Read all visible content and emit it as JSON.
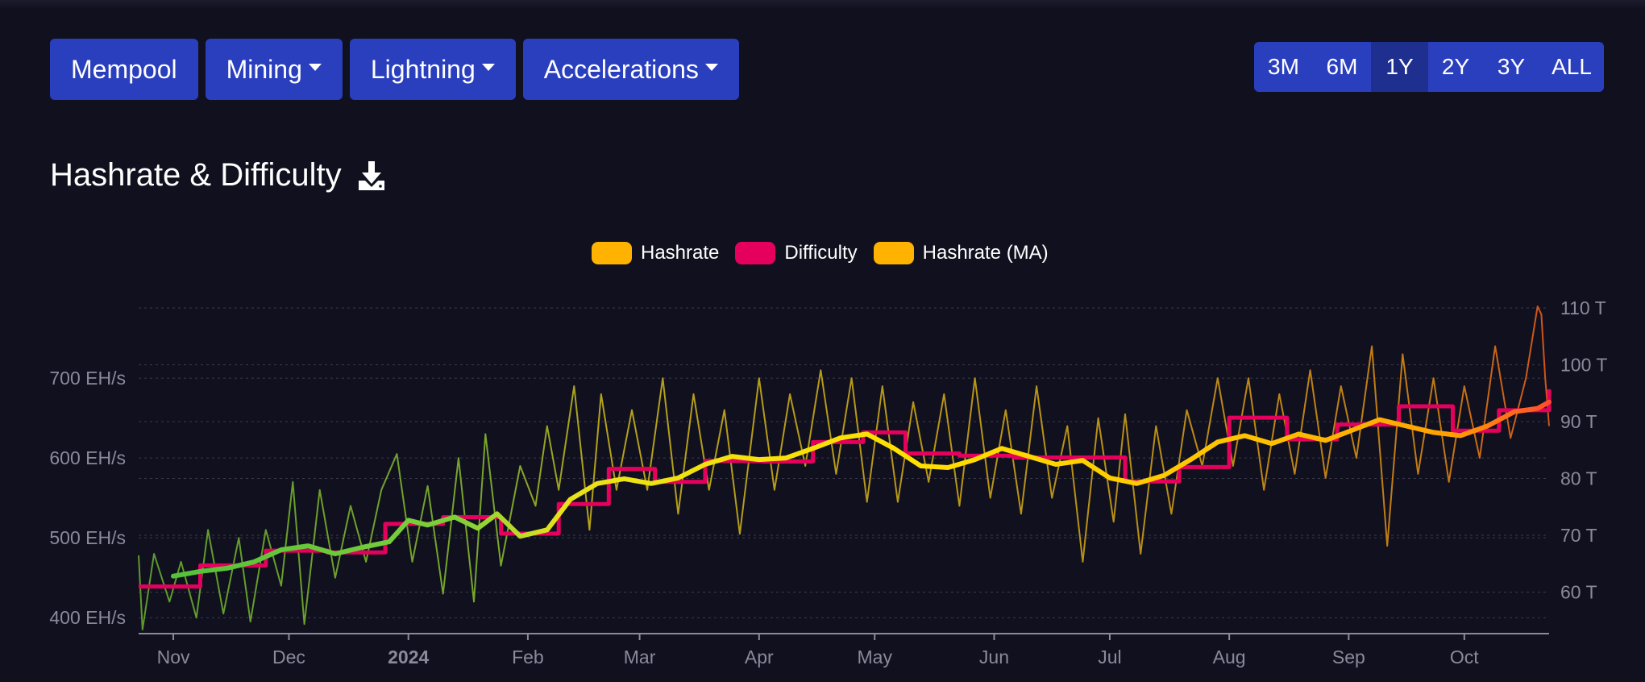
{
  "nav": {
    "items": [
      {
        "label": "Mempool",
        "dropdown": false
      },
      {
        "label": "Mining",
        "dropdown": true
      },
      {
        "label": "Lightning",
        "dropdown": true
      },
      {
        "label": "Accelerations",
        "dropdown": true
      }
    ]
  },
  "ranges": {
    "items": [
      "3M",
      "6M",
      "1Y",
      "2Y",
      "3Y",
      "ALL"
    ],
    "active": "1Y"
  },
  "page": {
    "title": "Hashrate & Difficulty",
    "download_icon": "download-icon"
  },
  "colors": {
    "background": "#11101f",
    "button": "#2a3fbe",
    "button_active": "#1e2f8f",
    "hashrate": "#ffb300",
    "difficulty": "#e5005e",
    "hashrate_ma": "#ffb300",
    "grid": "#3a3a4a",
    "axis_text": "#8a8a9a"
  },
  "chart_data": {
    "type": "line",
    "legend": {
      "position": "top-center",
      "entries": [
        {
          "name": "Hashrate",
          "color": "#ffb300"
        },
        {
          "name": "Difficulty",
          "color": "#e5005e"
        },
        {
          "name": "Hashrate (MA)",
          "color": "#ffb300"
        }
      ]
    },
    "x_ticks": [
      "Nov",
      "Dec",
      "2024",
      "Feb",
      "Mar",
      "Apr",
      "May",
      "Jun",
      "Jul",
      "Aug",
      "Sep",
      "Oct"
    ],
    "x_bold_tick": "2024",
    "x_range": [
      "2023-10-23",
      "2024-10-23"
    ],
    "y_left": {
      "ticks": [
        "400 EH/s",
        "500 EH/s",
        "600 EH/s",
        "700 EH/s"
      ],
      "tick_values": [
        400,
        500,
        600,
        700
      ],
      "range": [
        380,
        795
      ],
      "unit": "EH/s"
    },
    "y_right": {
      "ticks": [
        "60 T",
        "70 T",
        "80 T",
        "90 T",
        "100 T",
        "110 T"
      ],
      "tick_values": [
        60,
        70,
        80,
        90,
        100,
        110
      ],
      "range": [
        52.7,
        111
      ],
      "unit": "T"
    },
    "grid": true,
    "series": [
      {
        "name": "Difficulty",
        "axis": "right",
        "unit": "T",
        "color": "#e5005e",
        "steps": [
          [
            "2023-10-23",
            61.0
          ],
          [
            "2023-11-08",
            64.7
          ],
          [
            "2023-11-25",
            67.3
          ],
          [
            "2023-12-11",
            67.0
          ],
          [
            "2023-12-26",
            72.0
          ],
          [
            "2024-01-10",
            73.2
          ],
          [
            "2024-01-25",
            70.3
          ],
          [
            "2024-02-09",
            75.5
          ],
          [
            "2024-02-22",
            81.7
          ],
          [
            "2024-03-05",
            79.4
          ],
          [
            "2024-03-18",
            83.1
          ],
          [
            "2024-04-02",
            83.0
          ],
          [
            "2024-04-15",
            86.4
          ],
          [
            "2024-04-28",
            88.1
          ],
          [
            "2024-05-09",
            84.4
          ],
          [
            "2024-05-23",
            84.0
          ],
          [
            "2024-06-06",
            83.7
          ],
          [
            "2024-06-21",
            83.7
          ],
          [
            "2024-07-05",
            79.5
          ],
          [
            "2024-07-19",
            82.0
          ],
          [
            "2024-08-01",
            90.7
          ],
          [
            "2024-08-16",
            86.9
          ],
          [
            "2024-08-29",
            89.5
          ],
          [
            "2024-09-14",
            92.7
          ],
          [
            "2024-09-28",
            88.4
          ],
          [
            "2024-10-10",
            92.0
          ],
          [
            "2024-10-23",
            95.7
          ]
        ]
      },
      {
        "name": "Hashrate (MA)",
        "axis": "left",
        "unit": "EH/s",
        "color_gradient": [
          "#4fbf3a",
          "#ffe600",
          "#ffb300",
          "#ff4d2d"
        ],
        "points": [
          [
            "2023-11-01",
            452
          ],
          [
            "2023-11-08",
            458
          ],
          [
            "2023-11-15",
            462
          ],
          [
            "2023-11-22",
            470
          ],
          [
            "2023-11-29",
            485
          ],
          [
            "2023-12-06",
            490
          ],
          [
            "2023-12-13",
            480
          ],
          [
            "2023-12-20",
            488
          ],
          [
            "2023-12-27",
            495
          ],
          [
            "2024-01-01",
            522
          ],
          [
            "2024-01-06",
            516
          ],
          [
            "2024-01-13",
            526
          ],
          [
            "2024-01-19",
            512
          ],
          [
            "2024-01-24",
            530
          ],
          [
            "2024-01-30",
            502
          ],
          [
            "2024-02-06",
            510
          ],
          [
            "2024-02-12",
            548
          ],
          [
            "2024-02-19",
            568
          ],
          [
            "2024-02-26",
            574
          ],
          [
            "2024-03-04",
            568
          ],
          [
            "2024-03-11",
            575
          ],
          [
            "2024-03-18",
            592
          ],
          [
            "2024-03-25",
            602
          ],
          [
            "2024-04-01",
            598
          ],
          [
            "2024-04-08",
            600
          ],
          [
            "2024-04-15",
            612
          ],
          [
            "2024-04-22",
            625
          ],
          [
            "2024-04-29",
            630
          ],
          [
            "2024-05-06",
            612
          ],
          [
            "2024-05-13",
            590
          ],
          [
            "2024-05-20",
            588
          ],
          [
            "2024-05-27",
            598
          ],
          [
            "2024-06-03",
            612
          ],
          [
            "2024-06-10",
            602
          ],
          [
            "2024-06-17",
            592
          ],
          [
            "2024-06-24",
            597
          ],
          [
            "2024-07-01",
            575
          ],
          [
            "2024-07-08",
            568
          ],
          [
            "2024-07-15",
            578
          ],
          [
            "2024-07-22",
            598
          ],
          [
            "2024-07-29",
            620
          ],
          [
            "2024-08-05",
            628
          ],
          [
            "2024-08-12",
            618
          ],
          [
            "2024-08-19",
            630
          ],
          [
            "2024-08-26",
            622
          ],
          [
            "2024-09-02",
            635
          ],
          [
            "2024-09-09",
            648
          ],
          [
            "2024-09-16",
            640
          ],
          [
            "2024-09-23",
            632
          ],
          [
            "2024-09-30",
            628
          ],
          [
            "2024-10-07",
            640
          ],
          [
            "2024-10-14",
            658
          ],
          [
            "2024-10-20",
            662
          ],
          [
            "2024-10-23",
            670
          ]
        ]
      },
      {
        "name": "Hashrate",
        "axis": "left",
        "unit": "EH/s",
        "note_on_values": "daily estimates read approximately; daily noise around MA with range ~385 to ~790",
        "points": [
          [
            "2023-10-23",
            478
          ],
          [
            "2023-10-24",
            385
          ],
          [
            "2023-10-27",
            480
          ],
          [
            "2023-10-31",
            420
          ],
          [
            "2023-11-03",
            470
          ],
          [
            "2023-11-07",
            400
          ],
          [
            "2023-11-10",
            510
          ],
          [
            "2023-11-14",
            405
          ],
          [
            "2023-11-18",
            500
          ],
          [
            "2023-11-21",
            395
          ],
          [
            "2023-11-25",
            510
          ],
          [
            "2023-11-29",
            440
          ],
          [
            "2023-12-02",
            570
          ],
          [
            "2023-12-05",
            392
          ],
          [
            "2023-12-09",
            560
          ],
          [
            "2023-12-13",
            450
          ],
          [
            "2023-12-17",
            540
          ],
          [
            "2023-12-21",
            470
          ],
          [
            "2023-12-25",
            560
          ],
          [
            "2023-12-29",
            605
          ],
          [
            "2024-01-02",
            470
          ],
          [
            "2024-01-06",
            565
          ],
          [
            "2024-01-10",
            430
          ],
          [
            "2024-01-14",
            600
          ],
          [
            "2024-01-18",
            420
          ],
          [
            "2024-01-21",
            630
          ],
          [
            "2024-01-25",
            465
          ],
          [
            "2024-01-30",
            590
          ],
          [
            "2024-02-03",
            540
          ],
          [
            "2024-02-06",
            640
          ],
          [
            "2024-02-09",
            560
          ],
          [
            "2024-02-13",
            690
          ],
          [
            "2024-02-17",
            510
          ],
          [
            "2024-02-20",
            680
          ],
          [
            "2024-02-24",
            560
          ],
          [
            "2024-02-28",
            660
          ],
          [
            "2024-03-03",
            560
          ],
          [
            "2024-03-07",
            700
          ],
          [
            "2024-03-11",
            530
          ],
          [
            "2024-03-15",
            680
          ],
          [
            "2024-03-19",
            560
          ],
          [
            "2024-03-23",
            660
          ],
          [
            "2024-03-27",
            505
          ],
          [
            "2024-04-01",
            700
          ],
          [
            "2024-04-05",
            560
          ],
          [
            "2024-04-09",
            680
          ],
          [
            "2024-04-13",
            590
          ],
          [
            "2024-04-17",
            710
          ],
          [
            "2024-04-21",
            580
          ],
          [
            "2024-04-25",
            700
          ],
          [
            "2024-04-29",
            545
          ],
          [
            "2024-05-03",
            690
          ],
          [
            "2024-05-07",
            545
          ],
          [
            "2024-05-11",
            670
          ],
          [
            "2024-05-15",
            570
          ],
          [
            "2024-05-19",
            680
          ],
          [
            "2024-05-23",
            540
          ],
          [
            "2024-05-27",
            700
          ],
          [
            "2024-05-31",
            550
          ],
          [
            "2024-06-04",
            660
          ],
          [
            "2024-06-08",
            530
          ],
          [
            "2024-06-12",
            690
          ],
          [
            "2024-06-16",
            550
          ],
          [
            "2024-06-20",
            640
          ],
          [
            "2024-06-24",
            470
          ],
          [
            "2024-06-28",
            650
          ],
          [
            "2024-07-02",
            520
          ],
          [
            "2024-07-05",
            655
          ],
          [
            "2024-07-09",
            480
          ],
          [
            "2024-07-13",
            640
          ],
          [
            "2024-07-17",
            530
          ],
          [
            "2024-07-21",
            660
          ],
          [
            "2024-07-25",
            590
          ],
          [
            "2024-07-29",
            700
          ],
          [
            "2024-08-02",
            590
          ],
          [
            "2024-08-06",
            700
          ],
          [
            "2024-08-10",
            560
          ],
          [
            "2024-08-14",
            680
          ],
          [
            "2024-08-18",
            580
          ],
          [
            "2024-08-22",
            710
          ],
          [
            "2024-08-26",
            575
          ],
          [
            "2024-08-30",
            690
          ],
          [
            "2024-09-03",
            600
          ],
          [
            "2024-09-07",
            740
          ],
          [
            "2024-09-11",
            490
          ],
          [
            "2024-09-15",
            730
          ],
          [
            "2024-09-19",
            580
          ],
          [
            "2024-09-23",
            700
          ],
          [
            "2024-09-27",
            570
          ],
          [
            "2024-10-01",
            690
          ],
          [
            "2024-10-05",
            600
          ],
          [
            "2024-10-09",
            740
          ],
          [
            "2024-10-13",
            625
          ],
          [
            "2024-10-17",
            700
          ],
          [
            "2024-10-20",
            790
          ],
          [
            "2024-10-21",
            780
          ],
          [
            "2024-10-22",
            700
          ],
          [
            "2024-10-23",
            640
          ]
        ]
      }
    ]
  }
}
